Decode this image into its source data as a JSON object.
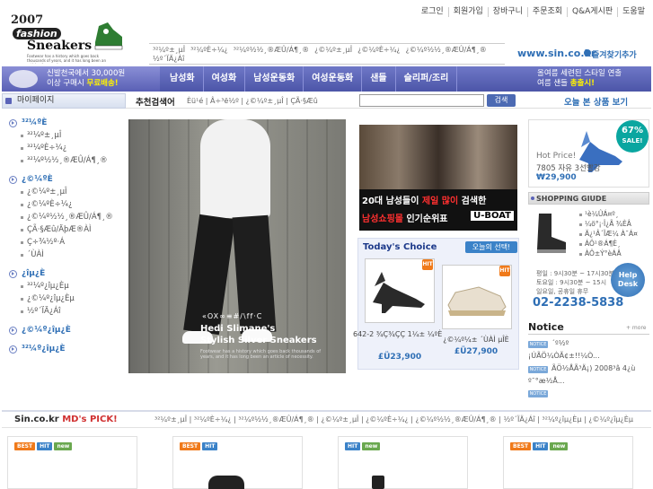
{
  "top_links": [
    "로그인",
    "회원가입",
    "장바구니",
    "주문조회",
    "Q&A게시판",
    "도움말"
  ],
  "logo": {
    "year": "2007",
    "fashion": "fashion",
    "sneakers": "Sneakers",
    "tagline": "Footwear has a history which goes back thousands of years, and it has long been an article of necessity."
  },
  "top_menu": [
    "³²¼º±¸µÎ",
    "³²¼ºÈ÷¼¿",
    "³²¼º½½¸®ÆÛ/Á¶¸®",
    "¿©¼º±¸µÎ",
    "¿©¼ºÈ÷¼¿",
    "¿©¼º½½¸®ÆÛ/Á¶¸®",
    "½º´ÏÄ¿Áî"
  ],
  "site_url": "www.sin.co.kr",
  "favorite_label": "즐겨찾기추가",
  "nav_promo_left": {
    "line1": "신발천국에서 30,000원",
    "line2_a": "이상 구매시 ",
    "line2_b": "무료배송!"
  },
  "nav_items": [
    "남성화",
    "여성화",
    "남성운동화",
    "여성운동화",
    "샌들",
    "슬리퍼/조리"
  ],
  "nav_promo_right": {
    "line1": "올여름 세련된 스타일 연출",
    "line2_a": "여름 샌들 ",
    "line2_b": "총출시!"
  },
  "mypage_label": "마이페이지",
  "reco_label": "추천검색어",
  "reco_words": "Èü¹é | Â÷³ë½º | ¿©¼º±¸µÎ | ÇÃ·§Æû",
  "search_button": "검색",
  "today_viewed": "오늘 본 상품 보기",
  "sidebar": [
    {
      "title": "³²¼ºÈ",
      "subs": [
        "³²¼º±¸µÎ",
        "³²¼ºÈ÷¼¿",
        "³²¼º½½¸®ÆÛ/Á¶¸®"
      ]
    },
    {
      "title": "¿©¼ºÈ",
      "subs": [
        "¿©¼º±¸µÎ",
        "¿©¼ºÈ÷¼¿",
        "¿©¼º½½¸®ÆÛ/Á¶¸®",
        "ÇÃ·§Æû/ÄþÆ®ÀÌ",
        "Ç÷¾½º·Á",
        "´ÙÀÌ"
      ]
    },
    {
      "title": "¿îµ¿È",
      "subs": [
        "³²¼º¿îµ¿Èµ",
        "¿©¼º¿îµ¿Èµ",
        "½º´ÏÄ¿Áî"
      ]
    },
    {
      "title": "¿©¼º¿îµ¿È",
      "subs": []
    },
    {
      "title": "³²¼º¿îµ¿È",
      "subs": []
    }
  ],
  "hero": {
    "brand": "«OX∞≡#/\\ff·C",
    "line1": "Hedi Slimane's",
    "line2": "Stylish Silver Sneakers",
    "small": "Footwear has a history which goes back thousands of years, and it has long been an article of necessity."
  },
  "uboat": {
    "line1_a": "20대 남성들이 ",
    "line1_b": "제일 많이",
    "line1_c": " 검색한",
    "line2_a": "남성쇼핑몰",
    "line2_b": " 인기순위표",
    "brand": "U-BOAT"
  },
  "todays_choice": {
    "title": "Today's Choice",
    "button": "오늘의 선택!",
    "products": [
      {
        "name": "642-2 ¾Ç¾ÇÇ 1¼± ¼ºÈ",
        "price": "£Ü23,900"
      },
      {
        "name": "¿©¼º¼± ´ÙÀÌ µÎÈ",
        "price": "£Ü27,900"
      }
    ]
  },
  "hot_price": {
    "label": "Hot Price!",
    "name": "7805 자유 3선빨강",
    "price": "₩29,900"
  },
  "sale_badge": {
    "pct": "67%",
    "text": "SALE!"
  },
  "shopping_guide": {
    "title": "SHOPPING GIUDE",
    "items": [
      "¹è¼ÛÁ¤º¸",
      "¼ö°¡·Î¿Ã ¾ÈÂ",
      "Ä¿¹Â´ÏÆ¼ À¯Á¤",
      "ÁÖ¹®Á¶È¸",
      "ÀÔ±Ý°èÁÂ"
    ]
  },
  "hours": [
    "평일 : 9시30분 ~ 17시30분",
    "토요일 : 9시30분 ~ 15시",
    "일요일, 공휴일 휴무"
  ],
  "phone": "02-2238-5838",
  "helpdesk": {
    "l1": "Help",
    "l2": "Desk"
  },
  "notice": {
    "title": "Notice",
    "more": "+ more",
    "badge": "NOTICE",
    "items": [
      "´º½º",
      "¡ÚÃÖ¼ÒÃ¢±!!¼Ò...",
      "ÃÖ½ÅÃ³Ä¡) 2008³â 4¿ù",
      "º¯°æ½Å..."
    ]
  },
  "md_pick": {
    "title_a": "Sin.co.kr ",
    "title_b": "MD's PICK!",
    "tabs": "³²¼º±¸µÎ | ³²¼ºÈ÷¼¿ | ³²¼º½½¸®ÆÛ/Á¶¸® | ¿©¼º±¸µÎ | ¿©¼ºÈ÷¼¿ | ¿©¼º½½¸®ÆÛ/Á¶¸® | ½º´ÏÄ¿Áî | ³²¼º¿îµ¿Èµ | ¿©¼º¿îµ¿Èµ"
  },
  "md_badges": {
    "best": "BEST",
    "hit": "HIT",
    "new": "new"
  },
  "colors": {
    "accent": "#2f6fb5",
    "nav": "#4c55a8",
    "hit": "#f07a1a"
  }
}
